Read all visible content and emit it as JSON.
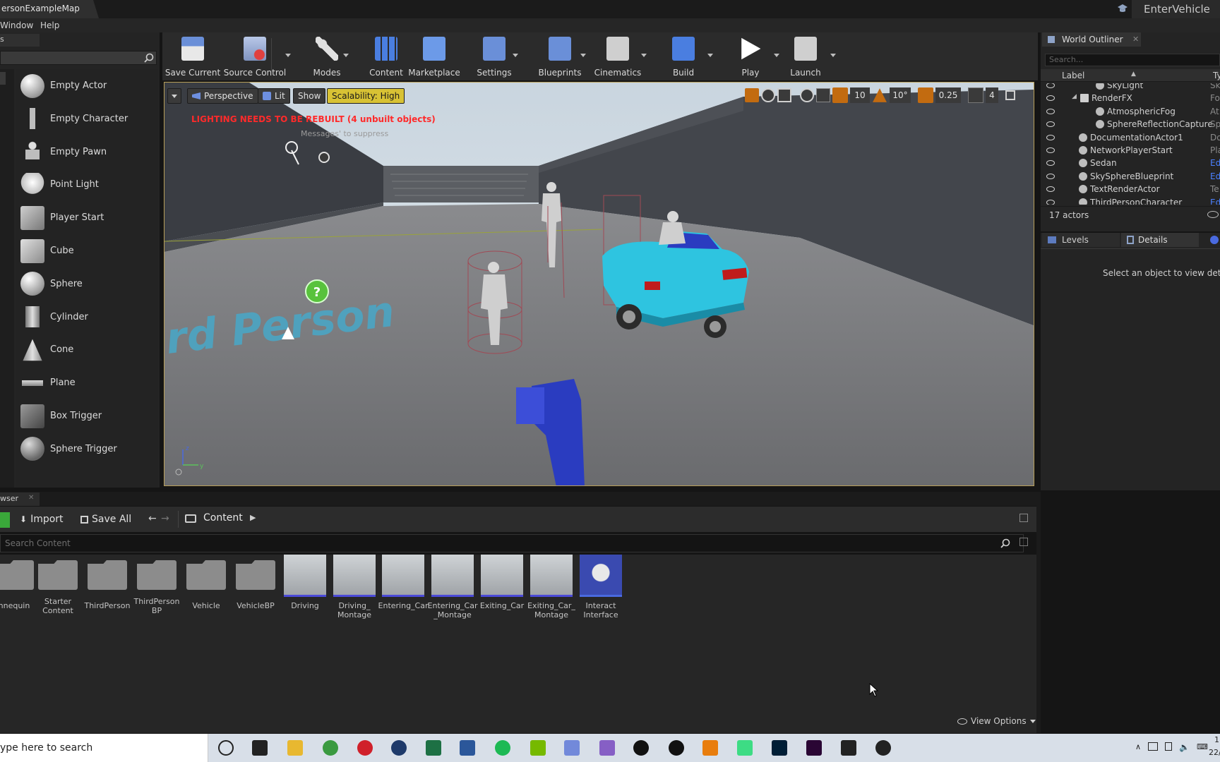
{
  "window": {
    "title": "ersonExampleMap",
    "right_title": "EnterVehicle"
  },
  "menu": [
    {
      "label": "Window"
    },
    {
      "label": "Help"
    }
  ],
  "modes_panel": {
    "tab_label": "s",
    "items": [
      {
        "label": "Empty Actor",
        "icon": "sphere-icon"
      },
      {
        "label": "Empty Character",
        "icon": "mannequin-icon"
      },
      {
        "label": "Empty Pawn",
        "icon": "pawn-icon"
      },
      {
        "label": "Point Light",
        "icon": "bulb-icon"
      },
      {
        "label": "Player Start",
        "icon": "player-start-icon"
      },
      {
        "label": "Cube",
        "icon": "cube-icon"
      },
      {
        "label": "Sphere",
        "icon": "sphere-icon"
      },
      {
        "label": "Cylinder",
        "icon": "cylinder-icon"
      },
      {
        "label": "Cone",
        "icon": "cone-icon"
      },
      {
        "label": "Plane",
        "icon": "plane-icon"
      },
      {
        "label": "Box Trigger",
        "icon": "box-trigger-icon"
      },
      {
        "label": "Sphere Trigger",
        "icon": "sphere-trigger-icon"
      }
    ]
  },
  "toolbar": {
    "buttons": [
      {
        "label": "Save Current",
        "icon": "save-icon"
      },
      {
        "label": "Source Control",
        "icon": "source-control-icon"
      },
      {
        "label": "Modes",
        "icon": "modes-icon"
      },
      {
        "label": "Content",
        "icon": "content-icon"
      },
      {
        "label": "Marketplace",
        "icon": "marketplace-icon"
      },
      {
        "label": "Settings",
        "icon": "settings-icon"
      },
      {
        "label": "Blueprints",
        "icon": "blueprints-icon"
      },
      {
        "label": "Cinematics",
        "icon": "cinematics-icon"
      },
      {
        "label": "Build",
        "icon": "build-icon"
      },
      {
        "label": "Play",
        "icon": "play-icon"
      },
      {
        "label": "Launch",
        "icon": "launch-icon"
      }
    ]
  },
  "viewport": {
    "perspective_label": "Perspective",
    "lit_label": "Lit",
    "show_label": "Show",
    "scalability_label": "Scalability: High",
    "warning": "LIGHTING NEEDS TO BE REBUILT (4 unbuilt objects)",
    "warning_sub": "Messages' to suppress",
    "grid_snap": "10",
    "rotation_snap": "10°",
    "scale_snap": "0.25",
    "camera_speed": "4",
    "floor_text": "ird Person"
  },
  "world_outliner": {
    "title": "World Outliner",
    "search_placeholder": "Search...",
    "col_label": "Label",
    "col_type": "Ty",
    "rows": [
      {
        "label": "SkyLight",
        "type": "Sk",
        "indent": 2
      },
      {
        "label": "RenderFX",
        "type": "Fo",
        "indent": 1
      },
      {
        "label": "AtmosphericFog",
        "type": "At",
        "indent": 2
      },
      {
        "label": "SphereReflectionCapture",
        "type": "Sp",
        "indent": 2
      },
      {
        "label": "DocumentationActor1",
        "type": "Do",
        "indent": 0
      },
      {
        "label": "NetworkPlayerStart",
        "type": "Pla",
        "indent": 0
      },
      {
        "label": "Sedan",
        "type": "Ed",
        "indent": 0
      },
      {
        "label": "SkySphereBlueprint",
        "type": "Ed",
        "indent": 0
      },
      {
        "label": "TextRenderActor",
        "type": "Te",
        "indent": 0
      },
      {
        "label": "ThirdPersonCharacter",
        "type": "Ed",
        "indent": 0
      }
    ],
    "count": "17 actors"
  },
  "details": {
    "tab_levels": "Levels",
    "tab_details": "Details",
    "empty_text": "Select an object to view details"
  },
  "content_browser": {
    "tab_label": "wser",
    "import_label": "Import",
    "save_all_label": "Save All",
    "path": "Content",
    "search_placeholder": "Search Content",
    "view_options": "View Options",
    "folders": [
      {
        "name": "nnequin"
      },
      {
        "name": "Starter\nContent"
      },
      {
        "name": "ThirdPerson"
      },
      {
        "name": "ThirdPerson\nBP"
      },
      {
        "name": "Vehicle"
      },
      {
        "name": "VehicleBP"
      }
    ],
    "assets": [
      {
        "name": "Driving"
      },
      {
        "name": "Driving_\nMontage"
      },
      {
        "name": "Entering_Car"
      },
      {
        "name": "Entering_Car\n_Montage"
      },
      {
        "name": "Exiting_Car"
      },
      {
        "name": "Exiting_Car_\nMontage"
      },
      {
        "name": "Interact\nInterface"
      }
    ]
  },
  "taskbar": {
    "search_placeholder": "ype here to search",
    "apps": [
      "cortana-icon",
      "task-view-icon",
      "file-explorer-icon",
      "chrome-icon",
      "opera-icon",
      "steam-icon",
      "excel-icon",
      "word-icon",
      "spotify-icon",
      "nvidia-icon",
      "discord-icon",
      "visual-studio-icon",
      "unreal-engine-icon",
      "unreal-engine-icon",
      "blender-icon",
      "app-icon",
      "photoshop-icon",
      "premiere-icon",
      "epic-games-icon",
      "github-icon"
    ],
    "clock_time": "1",
    "clock_date": "22/"
  },
  "colors": {
    "accent_yellow": "#d8c234",
    "warning_red": "#ff2a2a",
    "car": "#2ec4e0",
    "gizmo_blue": "#2a3cc0"
  }
}
